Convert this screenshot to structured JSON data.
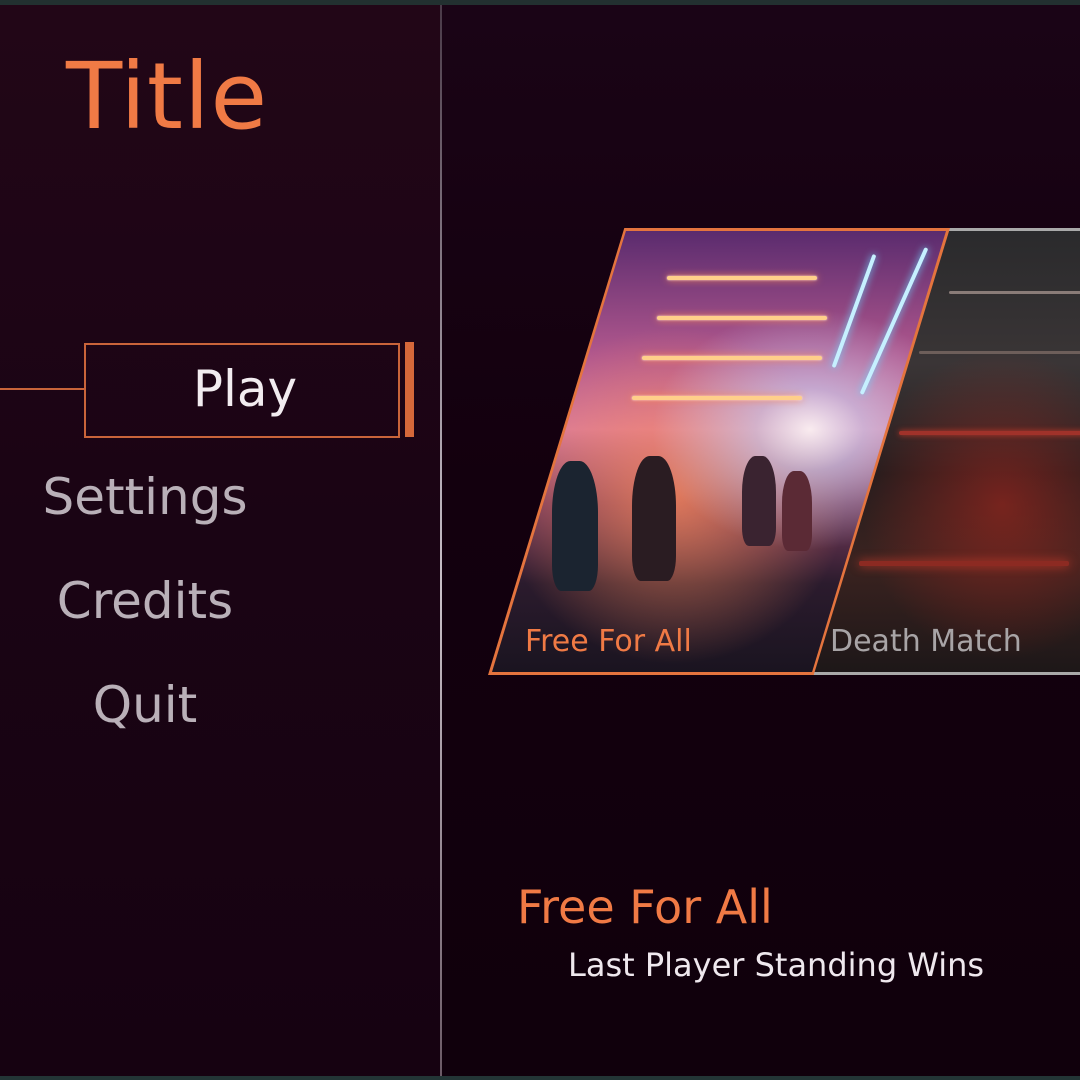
{
  "title": "Title",
  "menu": {
    "items": [
      {
        "label": "Play",
        "selected": true
      },
      {
        "label": "Settings",
        "selected": false
      },
      {
        "label": "Credits",
        "selected": false
      },
      {
        "label": "Quit",
        "selected": false
      }
    ]
  },
  "modes": [
    {
      "label": "Free For All",
      "selected": true
    },
    {
      "label": "Death Match",
      "selected": false
    }
  ],
  "selected_mode": {
    "name": "Free For All",
    "description": "Last Player Standing Wins"
  },
  "colors": {
    "accent": "#f07a45",
    "background": "#14000f",
    "menu_text": "#b9b0b8",
    "selected_text": "#f2ecf0",
    "inactive_card_border": "#a9a9a9"
  }
}
